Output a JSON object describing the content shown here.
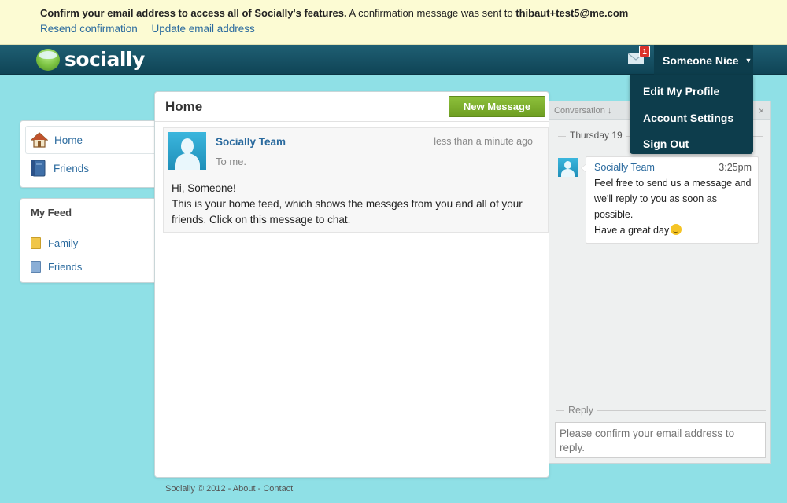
{
  "notice": {
    "bold_text": "Confirm your email address to access all of Socially's features.",
    "text": " A confirmation message was sent to ",
    "email": "thibaut+test5@me.com",
    "links": [
      "Resend confirmation",
      "Update email address"
    ]
  },
  "header": {
    "brand": "socially",
    "mail_badge": "1",
    "user_name": "Someone Nice",
    "dropdown": [
      "Edit My Profile",
      "Account Settings",
      "Sign Out"
    ]
  },
  "sidebar": {
    "nav": [
      {
        "label": "Home",
        "icon": "house-icon"
      },
      {
        "label": "Friends",
        "icon": "address-book-icon"
      }
    ],
    "feed_title": "My Feed",
    "feeds": [
      {
        "label": "Family",
        "color": "#f0c64a"
      },
      {
        "label": "Friends",
        "color": "#8aaed6"
      }
    ]
  },
  "main": {
    "title": "Home",
    "new_message_label": "New Message",
    "message": {
      "from": "Socially Team",
      "time": "less than a minute ago",
      "to": "To me.",
      "body_line1": "Hi, Someone!",
      "body_line2": "This is your home feed, which shows the messges from you and all of your friends. Click on this message to chat."
    }
  },
  "conversation": {
    "title": "Conversation ↓",
    "close": "×",
    "date": "Thursday 19",
    "from": "Socially Team",
    "time": "3:25pm",
    "text_1": "Feel free to send us a message and we'll reply to you as soon as possible.",
    "text_2": "Have a great day",
    "reply_label": "Reply",
    "reply_placeholder": "Please confirm your email address to reply."
  },
  "footer": {
    "copyright": "Socially © 2012",
    "about": "About",
    "contact": "Contact"
  },
  "colors": {
    "background": "#8fe0e6",
    "navbar": "#0f4456",
    "link": "#2a6a9e",
    "accent_green": "#7fb030",
    "badge_red": "#d9322a"
  }
}
